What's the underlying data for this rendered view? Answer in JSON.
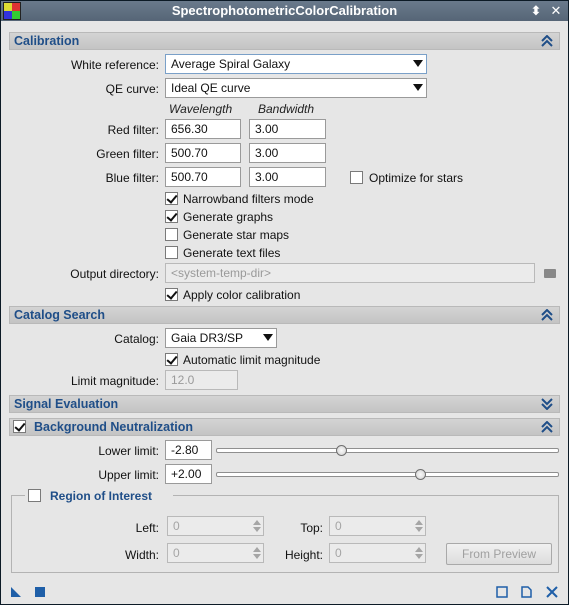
{
  "window": {
    "title": "SpectrophotometricColorCalibration"
  },
  "sections": {
    "calibration": "Calibration",
    "catalog_search": "Catalog Search",
    "signal_evaluation": "Signal Evaluation",
    "background_neutralization": "Background Neutralization",
    "region_of_interest": "Region of Interest"
  },
  "calibration": {
    "white_reference_label": "White reference:",
    "white_reference_value": "Average Spiral Galaxy",
    "qe_curve_label": "QE curve:",
    "qe_curve_value": "Ideal QE curve",
    "col_wavelength": "Wavelength",
    "col_bandwidth": "Bandwidth",
    "red_label": "Red filter:",
    "red_wavelength": "656.30",
    "red_bandwidth": "3.00",
    "green_label": "Green filter:",
    "green_wavelength": "500.70",
    "green_bandwidth": "3.00",
    "blue_label": "Blue filter:",
    "blue_wavelength": "500.70",
    "blue_bandwidth": "3.00",
    "optimize_stars_label": "Optimize for stars",
    "narrowband_label": "Narrowband filters mode",
    "generate_graphs_label": "Generate graphs",
    "generate_star_maps_label": "Generate star maps",
    "generate_text_files_label": "Generate text files",
    "output_dir_label": "Output directory:",
    "output_dir_placeholder": "<system-temp-dir>",
    "apply_color_calibration_label": "Apply color calibration"
  },
  "catalog": {
    "catalog_label": "Catalog:",
    "catalog_value": "Gaia DR3/SP",
    "auto_limit_label": "Automatic limit magnitude",
    "limit_mag_label": "Limit magnitude:",
    "limit_mag_value": "12.0"
  },
  "background": {
    "lower_label": "Lower limit:",
    "lower_value": "-2.80",
    "upper_label": "Upper limit:",
    "upper_value": "+2.00",
    "lower_slider_fraction": 0.36,
    "upper_slider_fraction": 0.59
  },
  "roi": {
    "left_label": "Left:",
    "left_value": "0",
    "top_label": "Top:",
    "top_value": "0",
    "width_label": "Width:",
    "width_value": "0",
    "height_label": "Height:",
    "height_value": "0",
    "from_preview_label": "From Preview"
  },
  "colors": {
    "section_title": "#1f4e88",
    "titlebar": "#5f6f80"
  }
}
